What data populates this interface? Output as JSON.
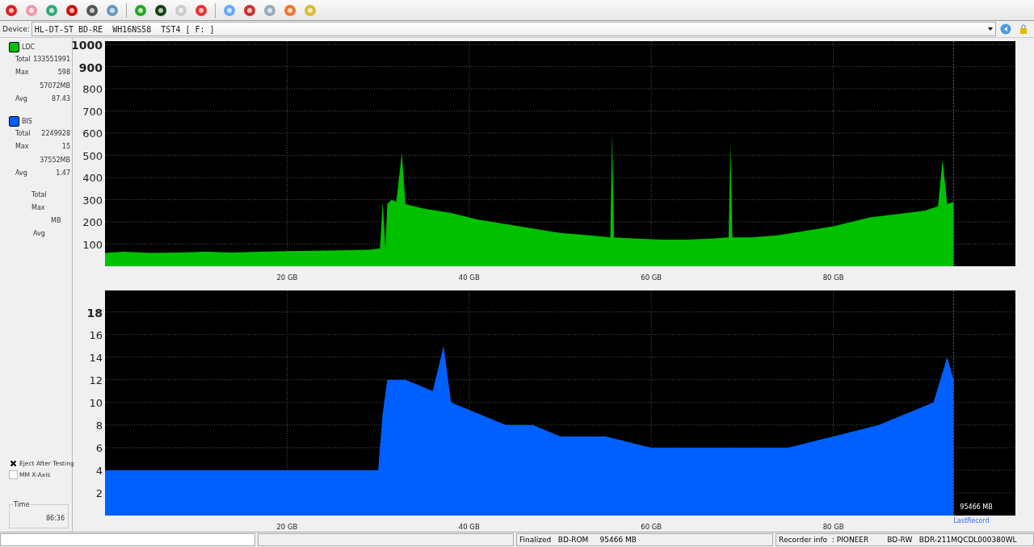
{
  "device": {
    "label": "Device:",
    "value": "HL-DT-ST BD-RE  WH16NS58  TST4 [ F: ]"
  },
  "stats": [
    {
      "rows": [
        {
          "key": "Total",
          "value": "133551991"
        },
        {
          "key": "Max",
          "value": "598"
        },
        {
          "key": "",
          "value": "57072MB"
        },
        {
          "key": "Avg",
          "value": "87.43"
        }
      ]
    },
    {
      "rows": [
        {
          "key": "Total",
          "value": "2249928"
        },
        {
          "key": "Max",
          "value": "15"
        },
        {
          "key": "",
          "value": "37552MB"
        },
        {
          "key": "Avg",
          "value": "1.47"
        }
      ]
    }
  ],
  "extra_stats": [
    "Total",
    "Max",
    "MB",
    "Avg"
  ],
  "options": [
    {
      "label": "Eject After Testing",
      "checked": true
    },
    {
      "label": "MM X-Axis",
      "checked": false
    }
  ],
  "time": {
    "label": "Time",
    "value": "86:36"
  },
  "charts": [
    {
      "chart_data": {
        "type": "area",
        "x": [
          0,
          2,
          5,
          8,
          11,
          14,
          17,
          20,
          23,
          26,
          29,
          30.2,
          30.5,
          30.8,
          31,
          31.5,
          32,
          32.6,
          33,
          35,
          38,
          41,
          44,
          47,
          50,
          53,
          55.5,
          55.7,
          55.9,
          58,
          61,
          64,
          67,
          68.5,
          68.7,
          68.9,
          71,
          74,
          77,
          80,
          82,
          84,
          86,
          88,
          90,
          91.5,
          92,
          92.5,
          93.2
        ],
        "series": [
          {
            "name": "LDC",
            "color": "#00c000",
            "values": [
              60,
              65,
              60,
              62,
              65,
              62,
              65,
              68,
              70,
              72,
              75,
              80,
              290,
              80,
              280,
              300,
              290,
              510,
              280,
              260,
              240,
              210,
              190,
              170,
              150,
              140,
              130,
              600,
              130,
              125,
              120,
              120,
              125,
              130,
              555,
              130,
              130,
              140,
              160,
              180,
              200,
              220,
              230,
              240,
              250,
              270,
              480,
              280,
              290
            ]
          }
        ],
        "xlim": [
          0,
          100
        ],
        "ylim": [
          0,
          1015
        ],
        "xticks": [
          {
            "value": 20,
            "label": "20 GB"
          },
          {
            "value": 40,
            "label": "40 GB"
          },
          {
            "value": 60,
            "label": "60 GB"
          },
          {
            "value": 80,
            "label": "80 GB"
          }
        ],
        "yticks": [
          100,
          200,
          300,
          400,
          500,
          600,
          700,
          800,
          900,
          1000
        ],
        "grid": true,
        "ref_lines": [
          {
            "axis": "x",
            "value": 93.2
          }
        ]
      }
    },
    {
      "chart_data": {
        "type": "area",
        "x": [
          0,
          5,
          10,
          15,
          20,
          25,
          30,
          30.5,
          31,
          33,
          36,
          37.2,
          38,
          41,
          44,
          47,
          50,
          55,
          60,
          65,
          70,
          75,
          80,
          85,
          88,
          91,
          92.5,
          93.2
        ],
        "series": [
          {
            "name": "BIS",
            "color": "#0060ff",
            "values": [
              4,
              4,
              4,
              4,
              4,
              4,
              4,
              9,
              12,
              12,
              11,
              15,
              10,
              9,
              8,
              8,
              7,
              7,
              6,
              6,
              6,
              6,
              7,
              8,
              9,
              10,
              14,
              12
            ]
          }
        ],
        "xlim": [
          0,
          100
        ],
        "ylim": [
          0,
          19.9
        ],
        "xticks": [
          {
            "value": 20,
            "label": "20 GB"
          },
          {
            "value": 40,
            "label": "40 GB"
          },
          {
            "value": 60,
            "label": "60 GB"
          },
          {
            "value": 80,
            "label": "80 GB"
          }
        ],
        "yticks": [
          2,
          4,
          6,
          8,
          10,
          12,
          14,
          16,
          18
        ],
        "grid": true,
        "ref_lines": [
          {
            "axis": "x",
            "value": 93.2,
            "label": "LastRecord"
          }
        ]
      },
      "end_label": "95466 MB"
    }
  ],
  "status_bar": {
    "disc": "Finalized   BD-ROM     95466 MB",
    "recorder": "Recorder info  : PIONEER        BD-RW   BDR-211MQCDL000380WL"
  }
}
